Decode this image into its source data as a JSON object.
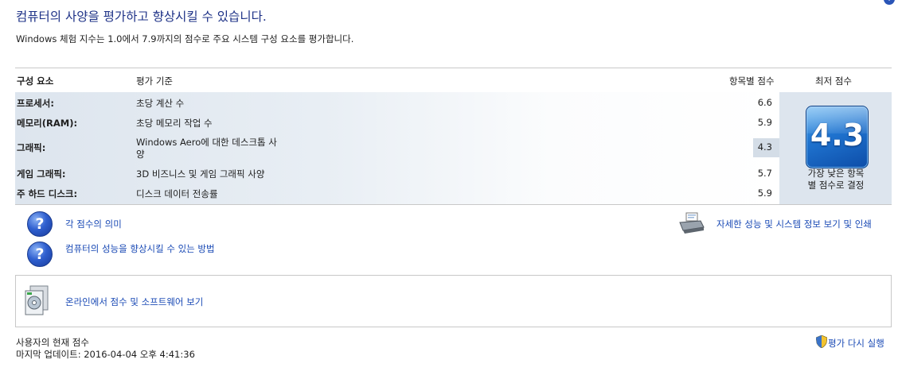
{
  "header": {
    "title": "컴퓨터의 사양을 평가하고 향상시킬 수 있습니다.",
    "subtitle": "Windows 체험 지수는 1.0에서 7.9까지의 점수로 주요 시스템 구성 요소를 평가합니다."
  },
  "table": {
    "columns": {
      "component": "구성 요소",
      "rating": "평가 기준",
      "subscore": "항목별 점수",
      "basescore": "최저 점수"
    },
    "rows": [
      {
        "component": "프로세서:",
        "rating": "초당 계산 수",
        "score": "6.6"
      },
      {
        "component": "메모리(RAM):",
        "rating": "초당 메모리 작업 수",
        "score": "5.9"
      },
      {
        "component": "그래픽:",
        "rating_line1": "Windows Aero에 대한 데스크톱 사",
        "rating_line2": "양",
        "score": "4.3"
      },
      {
        "component": "게임 그래픽:",
        "rating": "3D 비즈니스 및 게임 그래픽 사양",
        "score": "5.7"
      },
      {
        "component": "주 하드 디스크:",
        "rating": "디스크 데이터 전송률",
        "score": "5.9"
      }
    ],
    "base_score": "4.3",
    "base_caption_line1": "가장 낮은 항목",
    "base_caption_line2": "별 점수로 결정"
  },
  "links": {
    "what_scores_mean": "각 점수의 의미",
    "improve_performance": "컴퓨터의 성능을 향상시킬 수 있는 방법",
    "view_print_details": "자세한 성능 및 시스템 정보 보기 및 인쇄",
    "online_scores": "온라인에서 점수 및 소프트웨어 보기"
  },
  "footer": {
    "current_score_label": "사용자의 현재 점수",
    "last_update": "마지막 업데이트: 2016-04-04 오후 4:41:36",
    "rerun": "평가 다시 실행"
  },
  "icons": {
    "help": "question-mark-icon",
    "printer": "printer-icon",
    "software": "software-box-icon",
    "shield": "uac-shield-icon"
  },
  "colors": {
    "link": "#1a4ab5",
    "title": "#1e3287",
    "badge": "#1f73cf"
  }
}
